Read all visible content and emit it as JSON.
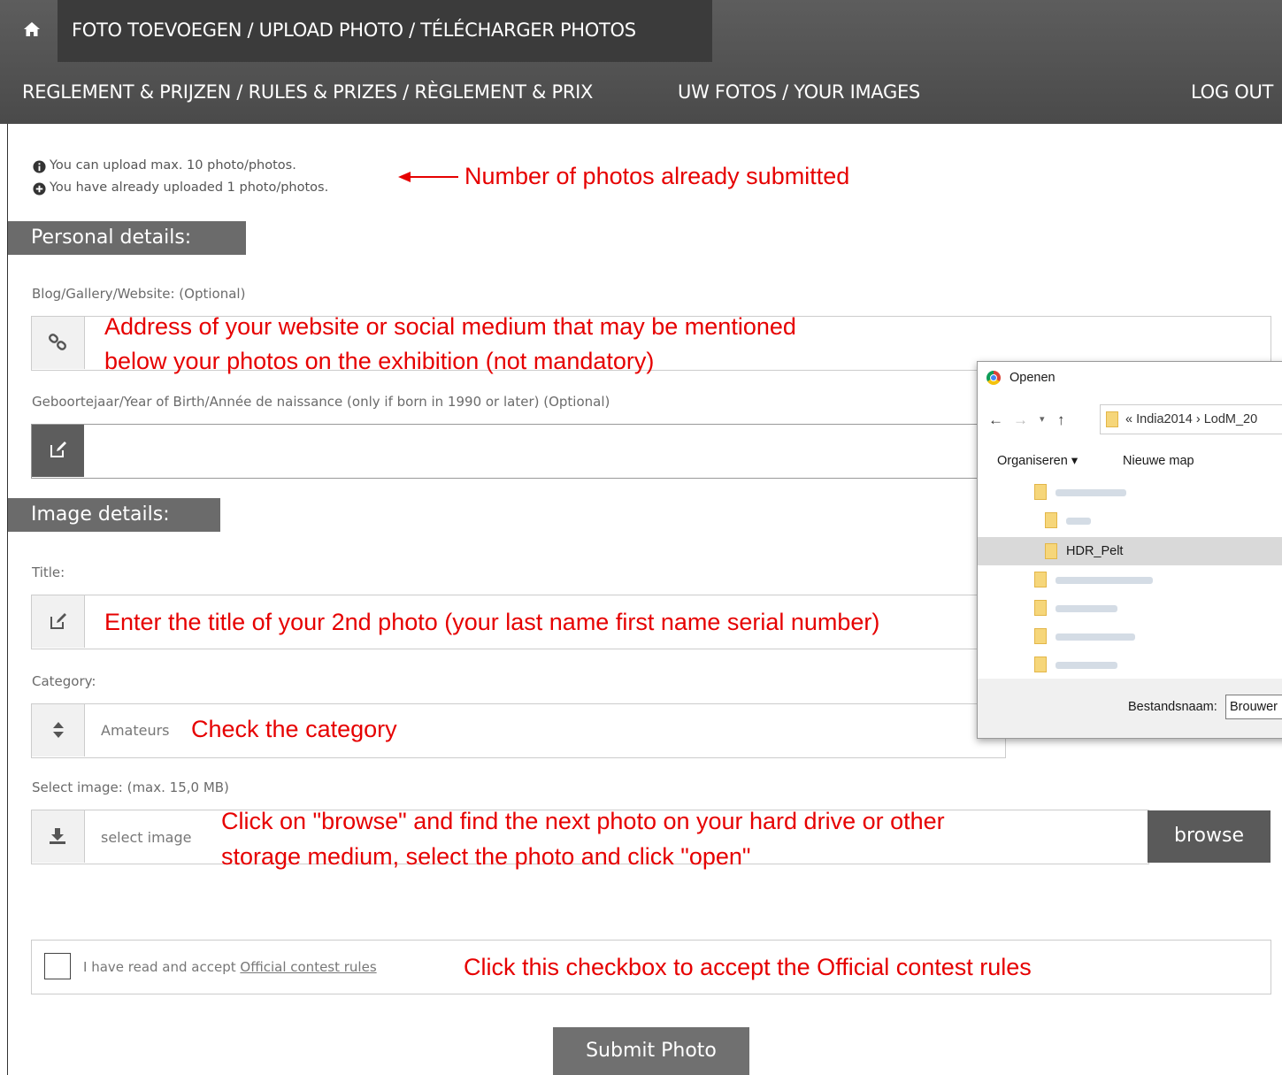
{
  "nav": {
    "home_icon": "home-icon",
    "upload": "FOTO TOEVOEGEN / UPLOAD PHOTO / TÉLÉCHARGER PHOTOS",
    "rules": "REGLEMENT & PRIJZEN / RULES & PRIZES / RÈGLEMENT & PRIX",
    "your_images": "UW FOTOS / YOUR IMAGES",
    "logout": "LOG OUT"
  },
  "info": {
    "max": "You can upload max. 10 photo/photos.",
    "uploaded": "You have already uploaded 1 photo/photos."
  },
  "annotations": {
    "submitted": "Number of photos already submitted",
    "website_1": "Address of your website or social medium that may be mentioned",
    "website_2": "below your photos on the exhibition (not mandatory)",
    "title": "Enter the title of your 2nd photo (your last name first name serial number)",
    "category": "Check the category",
    "browse_1": "Click on \"browse\" and find the next photo on your hard drive or other",
    "browse_2": "storage medium, select the photo and click \"open\"",
    "checkbox": "Click this checkbox to accept the Official contest rules"
  },
  "personal": {
    "heading": "Personal details:",
    "website_label": "Blog/Gallery/Website: (Optional)",
    "birth_label": "Geboortejaar/Year of Birth/Année de naissance (only if born in 1990 or later) (Optional)"
  },
  "image": {
    "heading": "Image details:",
    "title_label": "Title:",
    "category_label": "Category:",
    "category_value": "Amateurs",
    "select_label": "Select image: (max. 15,0 MB)",
    "select_placeholder": "select image",
    "browse": "browse"
  },
  "rules": {
    "prefix": "I have read and accept",
    "link": "Official contest rules"
  },
  "submit": "Submit Photo",
  "dialog": {
    "title": "Openen",
    "path_prefix": "«",
    "path_1": "India2014",
    "path_sep": "›",
    "path_2": "LodM_20",
    "organise": "Organiseren ▾",
    "new_folder": "Nieuwe map",
    "selected_folder": "HDR_Pelt",
    "filename_label": "Bestandsnaam:",
    "filename_value": "Brouwer"
  },
  "colors": {
    "annotation": "#e60000",
    "nav": "#4f4f4f",
    "button": "#5a5a5a"
  }
}
